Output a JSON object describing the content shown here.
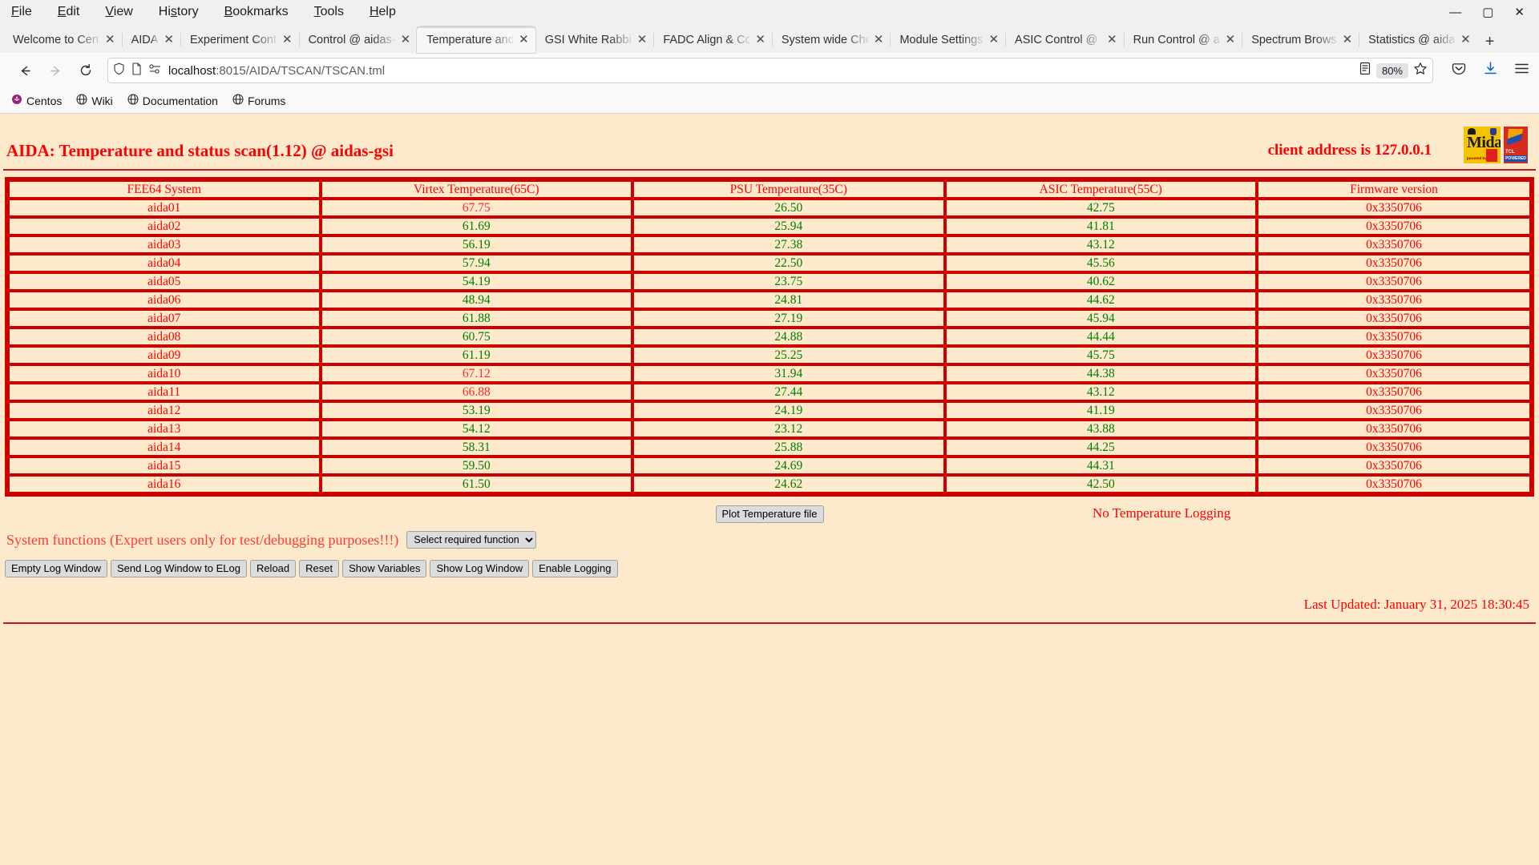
{
  "browser": {
    "menus": [
      "File",
      "Edit",
      "View",
      "History",
      "Bookmarks",
      "Tools",
      "Help"
    ],
    "window_controls": {
      "minimize": "—",
      "maximize": "▢",
      "close": "✕"
    },
    "tabs": [
      {
        "label": "Welcome to Cent",
        "active": false
      },
      {
        "label": "AIDA",
        "active": false
      },
      {
        "label": "Experiment Cont",
        "active": false
      },
      {
        "label": "Control @ aidas-",
        "active": false
      },
      {
        "label": "Temperature and",
        "active": true
      },
      {
        "label": "GSI White Rabbit",
        "active": false
      },
      {
        "label": "FADC Align & Co",
        "active": false
      },
      {
        "label": "System wide Che",
        "active": false
      },
      {
        "label": "Module Settings",
        "active": false
      },
      {
        "label": "ASIC Control @ a",
        "active": false
      },
      {
        "label": "Run Control @ ai",
        "active": false
      },
      {
        "label": "Spectrum Brows",
        "active": false
      },
      {
        "label": "Statistics @ aida",
        "active": false
      }
    ],
    "new_tab_label": "+",
    "tab_close_label": "✕",
    "url_prefix": "localhost",
    "url_suffix": ":8015/AIDA/TSCAN/TSCAN.tml",
    "zoom_level": "80%",
    "bookmarks": [
      {
        "label": "Centos",
        "icon": "centos-logo-icon"
      },
      {
        "label": "Wiki",
        "icon": "globe-icon"
      },
      {
        "label": "Documentation",
        "icon": "globe-icon"
      },
      {
        "label": "Forums",
        "icon": "globe-icon"
      }
    ]
  },
  "page": {
    "title": "AIDA: Temperature and status scan(1.12) @ aidas-gsi",
    "client_address": "client address is 127.0.0.1",
    "logos": {
      "midas": {
        "word": "idas",
        "m": "M",
        "powered_by": "powered by"
      },
      "tcl": {
        "word": "TCL",
        "powered": "POWERED"
      }
    },
    "table": {
      "headers": [
        "FEE64 System",
        "Virtex Temperature(65C)",
        "PSU Temperature(35C)",
        "ASIC Temperature(55C)",
        "Firmware version"
      ],
      "rows": [
        {
          "system": "aida01",
          "virtex": "67.75",
          "virtex_state": "hot",
          "psu": "26.50",
          "psu_state": "ok",
          "asic": "42.75",
          "asic_state": "ok",
          "firmware": "0x3350706"
        },
        {
          "system": "aida02",
          "virtex": "61.69",
          "virtex_state": "ok",
          "psu": "25.94",
          "psu_state": "ok",
          "asic": "41.81",
          "asic_state": "ok",
          "firmware": "0x3350706"
        },
        {
          "system": "aida03",
          "virtex": "56.19",
          "virtex_state": "ok",
          "psu": "27.38",
          "psu_state": "ok",
          "asic": "43.12",
          "asic_state": "ok",
          "firmware": "0x3350706"
        },
        {
          "system": "aida04",
          "virtex": "57.94",
          "virtex_state": "ok",
          "psu": "22.50",
          "psu_state": "ok",
          "asic": "45.56",
          "asic_state": "ok",
          "firmware": "0x3350706"
        },
        {
          "system": "aida05",
          "virtex": "54.19",
          "virtex_state": "ok",
          "psu": "23.75",
          "psu_state": "ok",
          "asic": "40.62",
          "asic_state": "ok",
          "firmware": "0x3350706"
        },
        {
          "system": "aida06",
          "virtex": "48.94",
          "virtex_state": "ok",
          "psu": "24.81",
          "psu_state": "ok",
          "asic": "44.62",
          "asic_state": "ok",
          "firmware": "0x3350706"
        },
        {
          "system": "aida07",
          "virtex": "61.88",
          "virtex_state": "ok",
          "psu": "27.19",
          "psu_state": "ok",
          "asic": "45.94",
          "asic_state": "ok",
          "firmware": "0x3350706"
        },
        {
          "system": "aida08",
          "virtex": "60.75",
          "virtex_state": "ok",
          "psu": "24.88",
          "psu_state": "ok",
          "asic": "44.44",
          "asic_state": "ok",
          "firmware": "0x3350706"
        },
        {
          "system": "aida09",
          "virtex": "61.19",
          "virtex_state": "ok",
          "psu": "25.25",
          "psu_state": "ok",
          "asic": "45.75",
          "asic_state": "ok",
          "firmware": "0x3350706"
        },
        {
          "system": "aida10",
          "virtex": "67.12",
          "virtex_state": "hot",
          "psu": "31.94",
          "psu_state": "ok",
          "asic": "44.38",
          "asic_state": "ok",
          "firmware": "0x3350706"
        },
        {
          "system": "aida11",
          "virtex": "66.88",
          "virtex_state": "hot",
          "psu": "27.44",
          "psu_state": "ok",
          "asic": "43.12",
          "asic_state": "ok",
          "firmware": "0x3350706"
        },
        {
          "system": "aida12",
          "virtex": "53.19",
          "virtex_state": "ok",
          "psu": "24.19",
          "psu_state": "ok",
          "asic": "41.19",
          "asic_state": "ok",
          "firmware": "0x3350706"
        },
        {
          "system": "aida13",
          "virtex": "54.12",
          "virtex_state": "ok",
          "psu": "23.12",
          "psu_state": "ok",
          "asic": "43.88",
          "asic_state": "ok",
          "firmware": "0x3350706"
        },
        {
          "system": "aida14",
          "virtex": "58.31",
          "virtex_state": "ok",
          "psu": "25.88",
          "psu_state": "ok",
          "asic": "44.25",
          "asic_state": "ok",
          "firmware": "0x3350706"
        },
        {
          "system": "aida15",
          "virtex": "59.50",
          "virtex_state": "ok",
          "psu": "24.69",
          "psu_state": "ok",
          "asic": "44.31",
          "asic_state": "ok",
          "firmware": "0x3350706"
        },
        {
          "system": "aida16",
          "virtex": "61.50",
          "virtex_state": "ok",
          "psu": "24.62",
          "psu_state": "ok",
          "asic": "42.50",
          "asic_state": "ok",
          "firmware": "0x3350706"
        }
      ]
    },
    "controls": {
      "plot_button": "Plot Temperature file",
      "logging_status": "No Temperature Logging",
      "system_functions_label": "System functions (Expert users only for test/debugging purposes!!!)",
      "function_select_value": "Select required function",
      "buttons": [
        "Empty Log Window",
        "Send Log Window to ELog",
        "Reload",
        "Reset",
        "Show Variables",
        "Show Log Window",
        "Enable Logging"
      ]
    },
    "last_updated": "Last Updated: January 31, 2025 18:30:45"
  },
  "colors": {
    "page_background": "#fdeacc",
    "accent_red": "#ff0000",
    "border_red": "#cc0000",
    "ok_green": "#008000"
  }
}
